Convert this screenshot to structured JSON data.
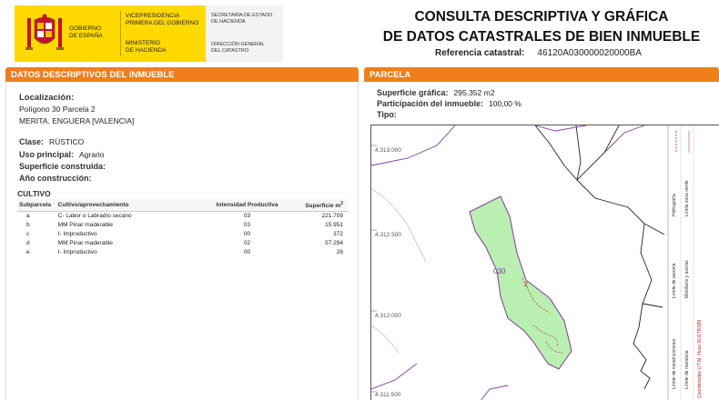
{
  "header": {
    "gov_name": "GOBIERNO\nDE ESPAÑA",
    "vicepresidencia": "VICEPRESIDENCIA\nPRIMERA DEL GOBIERNO",
    "ministerio": "MINISTERIO\nDE HACIENDA",
    "secretaria": "SECRETARÍA DE ESTADO\nDE HACIENDA",
    "direccion": "DIRECCIÓN GENERAL\nDEL CATASTRO",
    "title": "CONSULTA DESCRIPTIVA Y GRÁFICA\nDE DATOS CATASTRALES DE BIEN INMUEBLE",
    "ref_label": "Referencia catastral:",
    "ref_value": "46120A030000020000BA"
  },
  "left": {
    "section_title": "DATOS DESCRIPTIVOS DEL INMUEBLE",
    "localizacion_label": "Localización:",
    "localizacion_line1": "Polígono 30 Parcela 2",
    "localizacion_line2": "MERITA. ENGUERA [VALENCIA]",
    "clase_label": "Clase:",
    "clase_value": "RÚSTICO",
    "uso_label": "Uso principal:",
    "uso_value": "Agrario",
    "superficie_construida_label": "Superficie construida:",
    "anio_label": "Año construcción:",
    "cultivo_title": "CULTIVO",
    "table_headers": {
      "subparcela": "Subparcela",
      "cultivo": "Cultivo/aprovechamiento",
      "intensidad": "Intensidad Productiva",
      "superficie": "Superficie m",
      "superficie_sup": "2"
    },
    "rows": [
      {
        "sub": "a",
        "cult": "C- Labor o Labradío secano",
        "int": "03",
        "sup": "221.709"
      },
      {
        "sub": "b",
        "cult": "MM Pinar maderable",
        "int": "03",
        "sup": "15.951"
      },
      {
        "sub": "c",
        "cult": "I- Improductivo",
        "int": "00",
        "sup": "372"
      },
      {
        "sub": "d",
        "cult": "MM Pinar maderable",
        "int": "02",
        "sup": "57.294"
      },
      {
        "sub": "e",
        "cult": "I- Improductivo",
        "int": "00",
        "sup": "26"
      }
    ]
  },
  "right": {
    "section_title": "PARCELA",
    "superficie_grafica_label": "Superficie gráfica:",
    "superficie_grafica_value": "295.352 m2",
    "participacion_label": "Participación del inmueble:",
    "participacion_value": "100,00 %",
    "tipo_label": "Tipo:",
    "map": {
      "coord_1": "4.313.000",
      "coord_2": "4.312.500",
      "coord_3": "4.312.000",
      "coord_4": "4.311.500",
      "parcel_label": "030",
      "parcel_number": "2",
      "legend_1": "Hidrografía",
      "legend_2": "Límite de parcela",
      "legend_3": "Límite de construcciones",
      "legend_4": "Límite de manzana",
      "legend_5": "Límite zona verde",
      "legend_6": "Mobiliario y aceras",
      "legend_7": "Coordenadas U.T.M. Huso 30 ETRS89",
      "parcel_fill": "#b9efb0",
      "boundary_color": "#7c3d96",
      "contour_color": "#c070c0"
    }
  },
  "colors": {
    "accent": "#ef7f1a",
    "gov_yellow": "#ffd900"
  }
}
